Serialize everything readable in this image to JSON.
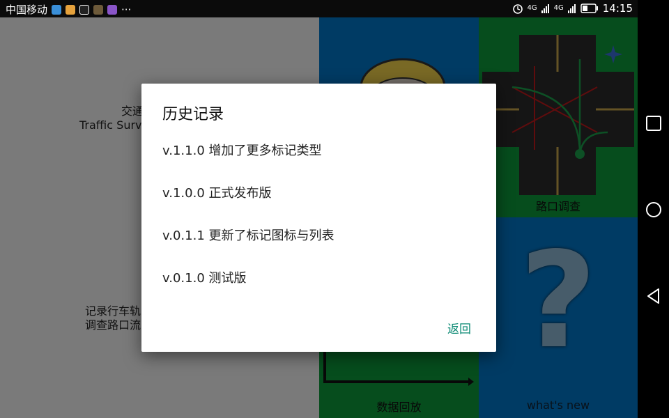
{
  "status_bar": {
    "carrier": "中国移动",
    "more": "···",
    "network_1": "4G",
    "network_2": "4G",
    "time": "14:15"
  },
  "background": {
    "left_panel": {
      "line1": "交通",
      "line2": "Traffic Surv",
      "line3": "记录行车轨",
      "line4": "调查路口流"
    },
    "tiles": {
      "intersection_label": "路口调查",
      "playback_label": "数据回放",
      "whats_new_label": "what's new",
      "question_mark": "?"
    }
  },
  "dialog": {
    "title": "历史记录",
    "items": [
      "v.1.1.0 增加了更多标记类型",
      "v.1.0.0 正式发布版",
      "v.0.1.1 更新了标记图标与列表",
      "v.0.1.0 测试版"
    ],
    "back_button": "返回"
  },
  "colors": {
    "tile_blue": "#0076c8",
    "tile_green": "#0c9a3a",
    "accent_teal": "#0b8a74"
  }
}
